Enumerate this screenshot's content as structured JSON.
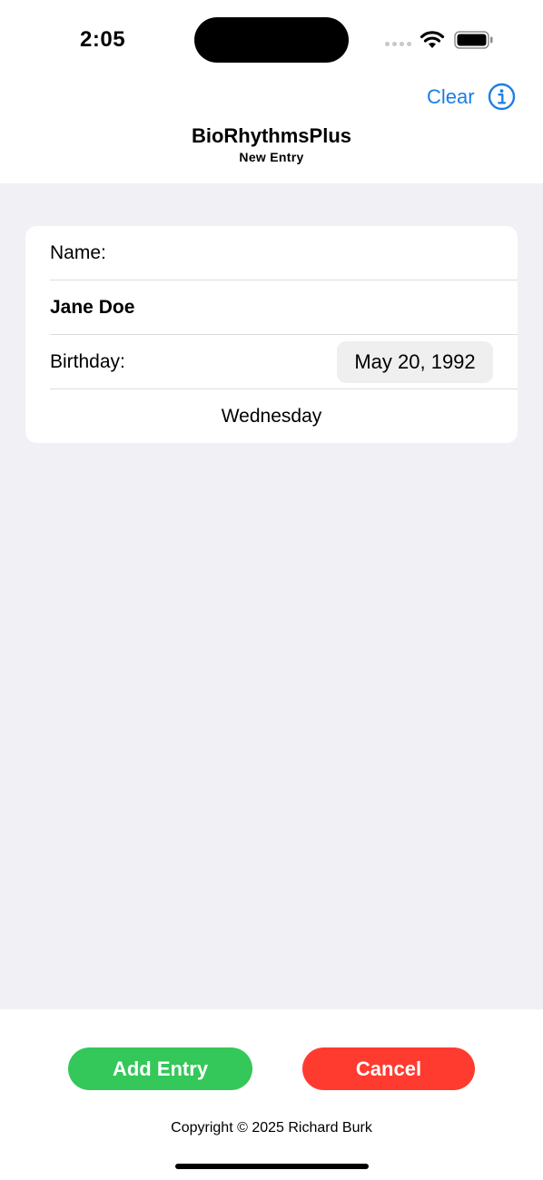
{
  "status_bar": {
    "time": "2:05"
  },
  "nav": {
    "clear_label": "Clear",
    "title": "BioRhythmsPlus",
    "subtitle": "New Entry"
  },
  "form": {
    "name_label": "Name:",
    "name_value": "Jane Doe",
    "birthday_label": "Birthday:",
    "birthday_value": "May 20, 1992",
    "weekday": "Wednesday"
  },
  "actions": {
    "add_label": "Add Entry",
    "cancel_label": "Cancel"
  },
  "footer": {
    "copyright": "Copyright © 2025 Richard Burk"
  },
  "colors": {
    "accent": "#1a7ee6",
    "add": "#34c759",
    "cancel": "#ff3b30",
    "background": "#f0f0f5"
  },
  "icons": [
    "wifi-icon",
    "battery-icon",
    "info-icon"
  ]
}
